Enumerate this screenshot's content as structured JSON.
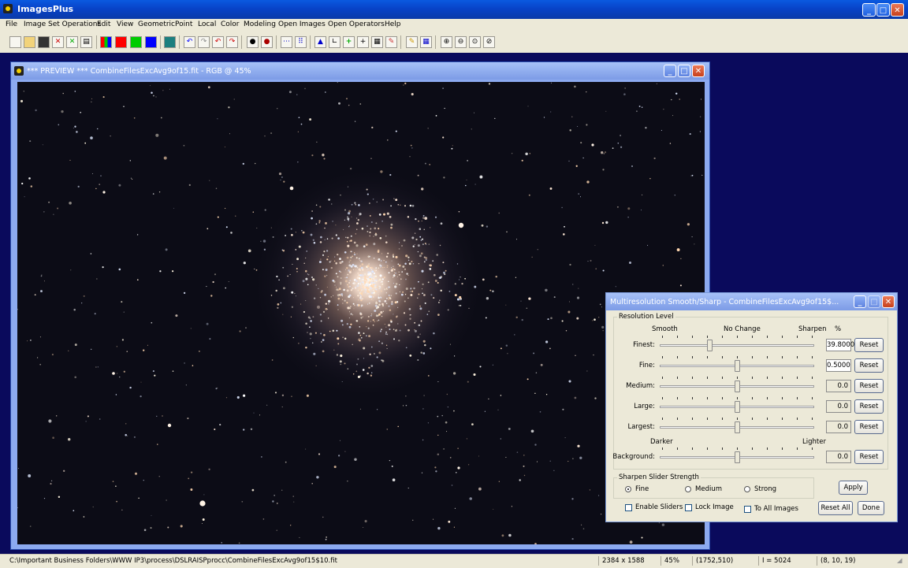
{
  "app": {
    "title": "ImagesPlus",
    "window_controls": [
      "_",
      "□",
      "✕"
    ]
  },
  "menu": [
    "File",
    "Image Set Operations",
    "Edit",
    "View",
    "Geometric",
    "Point",
    "Local",
    "Color",
    "Modeling",
    "Open Images",
    "Open Operators",
    "Help"
  ],
  "toolbar": {
    "icons": [
      "new-icon",
      "open-icon",
      "save-icon",
      "close-red-icon",
      "close-green-icon",
      "print-icon",
      "rgb-icon",
      "red-channel-icon",
      "green-channel-icon",
      "blue-channel-icon",
      "grid-icon",
      "undo-icon",
      "redo-icon",
      "undo2-icon",
      "redo2-icon",
      "dark-icon",
      "light-icon",
      "dots-icon",
      "chart-icon",
      "triangle-icon",
      "corner-icon",
      "plus-icon",
      "crosshair-icon",
      "table-icon",
      "color-picker-icon",
      "pencil-icon",
      "matrix-icon",
      "zoom-in-icon",
      "zoom-out-icon",
      "zoom-fit-icon",
      "zoom-actual-icon"
    ],
    "channel_colors": {
      "red": "#ff0000",
      "green": "#00cc00",
      "blue": "#0000ff"
    }
  },
  "preview": {
    "title": "*** PREVIEW *** CombineFilesExcAvg9of15.fit - RGB @ 45%"
  },
  "dialog": {
    "title": "Multiresolution Smooth/Sharp - CombineFilesExcAvg9of15$...",
    "resolution_group": "Resolution Level",
    "header": {
      "smooth": "Smooth",
      "no_change": "No Change",
      "sharpen": "Sharpen",
      "percent": "%"
    },
    "darker": "Darker",
    "lighter": "Lighter",
    "sliders": [
      {
        "label": "Finest:",
        "value": "39.8000",
        "level": 0.32,
        "white": true
      },
      {
        "label": "Fine:",
        "value": "0.5000",
        "level": 0.5,
        "white": true
      },
      {
        "label": "Medium:",
        "value": "0.0",
        "level": 0.5,
        "white": false
      },
      {
        "label": "Large:",
        "value": "0.0",
        "level": 0.5,
        "white": false
      },
      {
        "label": "Largest:",
        "value": "0.0",
        "level": 0.5,
        "white": false
      },
      {
        "label": "Background:",
        "value": "0.0",
        "level": 0.5,
        "white": false
      }
    ],
    "reset_label": "Reset",
    "strength_group": "Sharpen Slider Strength",
    "strength_options": [
      {
        "label": "Fine",
        "selected": true
      },
      {
        "label": "Medium",
        "selected": false
      },
      {
        "label": "Strong",
        "selected": false
      }
    ],
    "apply": "Apply",
    "checkboxes": [
      "Enable Sliders",
      "Lock Image",
      "To All Images"
    ],
    "reset_all": "Reset All",
    "done": "Done"
  },
  "status": {
    "path": "C:\\Important Business Folders\\WWW IP3\\process\\DSLRAISPprocc\\CombineFilesExcAvg9of15$10.fit",
    "dimensions": "2384 x 1588",
    "zoom": "45%",
    "coords": "(1752,510)",
    "intensity": "I = 5024",
    "rgb": "(8, 10, 19)"
  }
}
